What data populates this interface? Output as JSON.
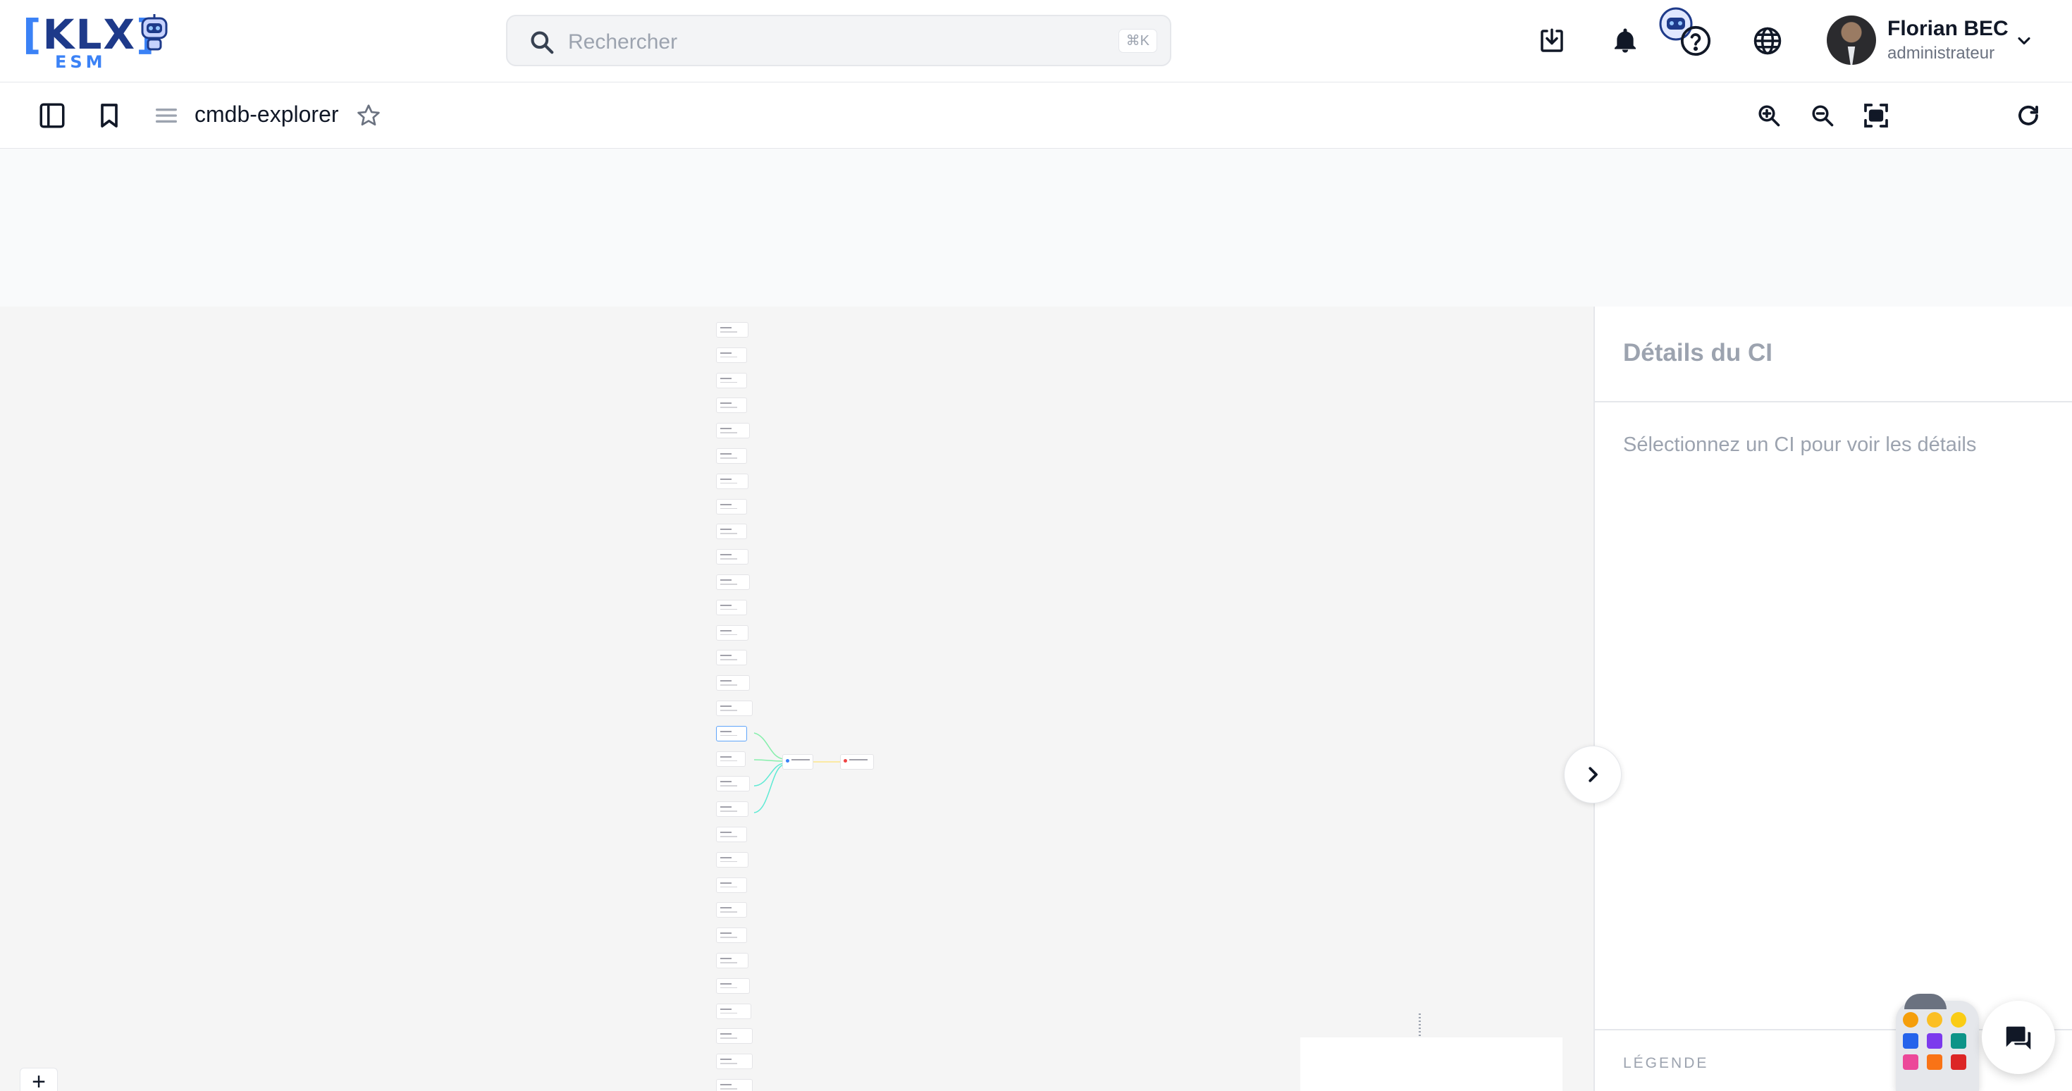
{
  "header": {
    "logo": {
      "brand": "KLX",
      "sub": "ESM"
    },
    "search": {
      "placeholder": "Rechercher",
      "shortcut": "⌘K"
    },
    "icons": [
      "download-icon",
      "bell-icon",
      "ai-assistant-icon",
      "help-icon",
      "globe-icon"
    ],
    "user": {
      "name": "Florian BEC",
      "role": "administrateur"
    }
  },
  "toolbar": {
    "page_title": "cmdb-explorer",
    "left_icons": [
      "sidebar-toggle-icon",
      "bookmark-icon",
      "menu-icon",
      "star-icon"
    ],
    "right_icons": [
      "zoom-in-icon",
      "zoom-out-icon",
      "fit-view-icon",
      "refresh-icon"
    ]
  },
  "graph": {
    "node_count_left_column": 31,
    "zoom_control": "+"
  },
  "details_panel": {
    "title": "Détails du CI",
    "hint": "Sélectionnez un CI pour voir les détails",
    "legend_label": "LÉGENDE"
  },
  "colors": {
    "brand_dark": "#1e3a8a",
    "brand_light": "#3b82f6",
    "edge_green": "#86efac",
    "edge_teal": "#5eead4",
    "edge_yellow": "#fde68a",
    "node_red": "#ef4444",
    "node_blue": "#3b82f6"
  }
}
